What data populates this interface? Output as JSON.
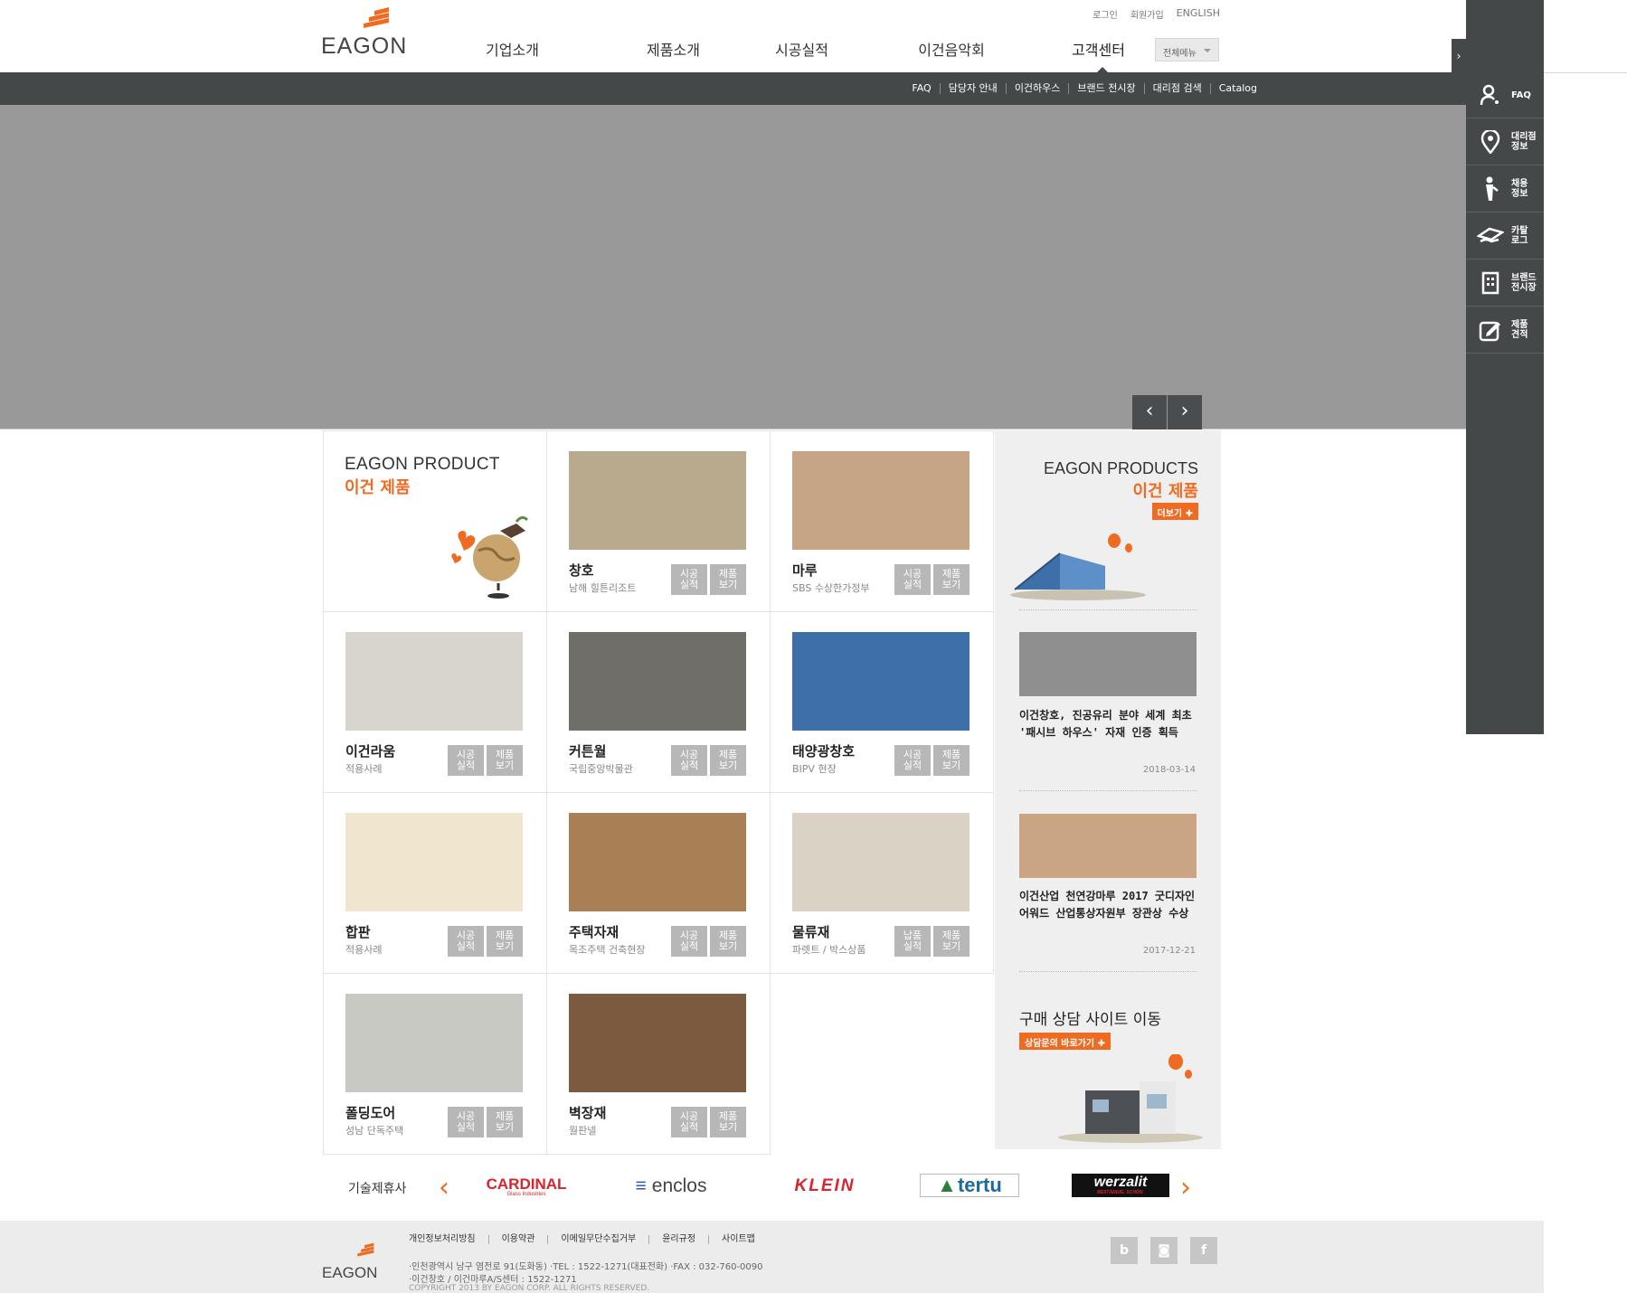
{
  "brand": {
    "logo_text": "EAGON",
    "accent": "#ef6b22",
    "dark": "#454849"
  },
  "utility": {
    "login": "로그인",
    "join": "회원가입",
    "english": "ENGLISH"
  },
  "nav": {
    "items": [
      "기업소개",
      "제품소개",
      "시공실적",
      "이건음악회",
      "고객센터"
    ],
    "all_menu": "전체메뉴"
  },
  "subnav": [
    "FAQ",
    "담당자 안내",
    "이건하우스",
    "브랜드 전시장",
    "대리점 검색",
    "Catalog"
  ],
  "hero": {
    "prev_icon": "chevron-left-icon",
    "next_icon": "chevron-right-icon"
  },
  "quick_rail": [
    {
      "label": "FAQ",
      "icon": "faq-user-icon"
    },
    {
      "label": "대리점 정보",
      "icon": "map-pin-icon"
    },
    {
      "label": "채용 정보",
      "icon": "person-icon"
    },
    {
      "label": "카탈 로그",
      "icon": "catalog-hand-icon"
    },
    {
      "label": "브랜드 전시장",
      "icon": "building-icon"
    },
    {
      "label": "제품 견적",
      "icon": "edit-icon"
    }
  ],
  "intro": {
    "title_en": "EAGON PRODUCT",
    "title_ko": "이건 제품"
  },
  "products": [
    {
      "name": "창호",
      "desc": "남해 힐튼리조트",
      "btn1": "시공실적",
      "btn2": "제품보기",
      "img": "#b9a98d"
    },
    {
      "name": "마루",
      "desc": "SBS 수상한가정부",
      "btn1": "시공실적",
      "btn2": "제품보기",
      "img": "#c6a486"
    },
    {
      "name": "이건라움",
      "desc": "적용사례",
      "btn1": "시공실적",
      "btn2": "제품보기",
      "img": "#d8d5cf"
    },
    {
      "name": "커튼월",
      "desc": "국립중앙박물관",
      "btn1": "시공실적",
      "btn2": "제품보기",
      "img": "#6f6e68"
    },
    {
      "name": "태양광창호",
      "desc": "BIPV 현장",
      "btn1": "시공실적",
      "btn2": "제품보기",
      "img": "#3f6fa8"
    },
    {
      "name": "합판",
      "desc": "적용사례",
      "btn1": "시공실적",
      "btn2": "제품보기",
      "img": "#f0e5cf"
    },
    {
      "name": "주택자재",
      "desc": "목조주택 건축현장",
      "btn1": "시공실적",
      "btn2": "제품보기",
      "img": "#a98055"
    },
    {
      "name": "물류재",
      "desc": "파렛트 / 박스상품",
      "btn1": "납품실적",
      "btn2": "제품보기",
      "img": "#d9d2c5"
    },
    {
      "name": "폴딩도어",
      "desc": "성남 단독주택",
      "btn1": "시공실적",
      "btn2": "제품보기",
      "img": "#c9c9c4"
    },
    {
      "name": "벽장재",
      "desc": "월판넬",
      "btn1": "시공실적",
      "btn2": "제품보기",
      "img": "#7b5a3f"
    }
  ],
  "sidebar": {
    "title_en": "EAGON PRODUCTS",
    "title_ko": "이건 제품",
    "more": "더보기 ✚",
    "news": [
      {
        "title": "이건창호, 진공유리 분야 세계 최초 '패시브 하우스' 자재 인증 획득",
        "date": "2018-03-14",
        "img": "#8f8f8f"
      },
      {
        "title": "이건산업 천연강마루 2017 굿디자인 어워드 산업통상자원부 장관상 수상",
        "date": "2017-12-21",
        "img": "#c9a583"
      }
    ],
    "buy_title": "구매 상담 사이트 이동",
    "buy_button": "상담문의 바로가기 ✚"
  },
  "partners": {
    "label": "기술제휴사",
    "logos": [
      "CARDINAL",
      "enclos",
      "KLEIN",
      "tertu",
      "werzalit"
    ],
    "cardinal_sub": "Glass Industries",
    "werzalit_sub": "BESTÄNDIG. SCHÖN."
  },
  "footer": {
    "links": [
      "개인정보처리방침",
      "이용약관",
      "이메일무단수집거부",
      "윤리규정",
      "사이트맵"
    ],
    "address": "·인천광역시 남구 염전로 91(도화동)   ·TEL : 1522-1271(대표전화)   ·FAX : 032-760-0090",
    "service": "·이건창호 / 이건마루A/S센터 : 1522-1271",
    "copyright": "COPYRIGHT 2013 BY EAGON CORP. ALL RIGHTS RESERVED.",
    "social": [
      "blog-icon",
      "instagram-icon",
      "facebook-icon"
    ]
  }
}
